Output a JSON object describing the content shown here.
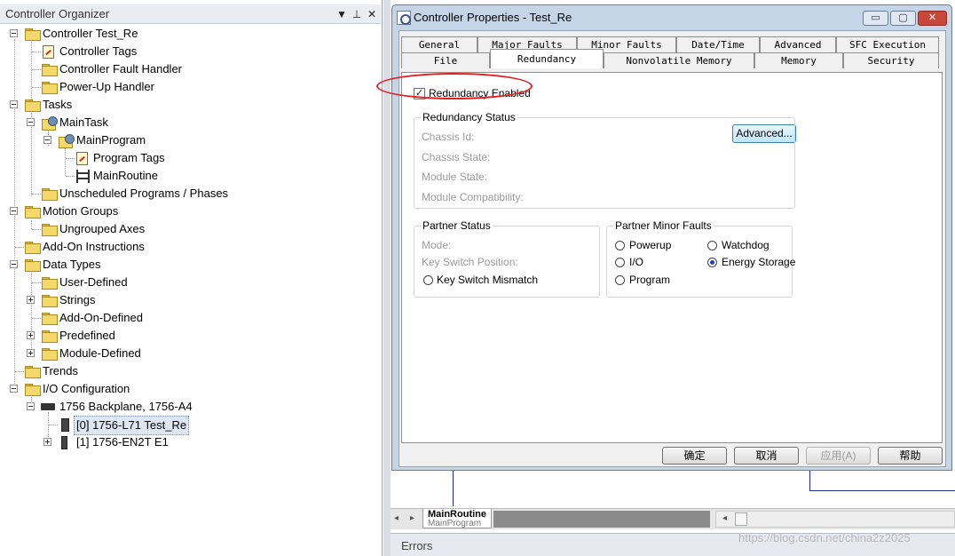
{
  "organizer": {
    "title": "Controller Organizer",
    "pin_glyph": "▼ ⊥",
    "close_glyph": "✕",
    "tree": {
      "controller": "Controller Test_Re",
      "controller_tags": "Controller Tags",
      "fault_handler": "Controller Fault Handler",
      "powerup_handler": "Power-Up Handler",
      "tasks": "Tasks",
      "main_task": "MainTask",
      "main_program": "MainProgram",
      "program_tags": "Program Tags",
      "main_routine": "MainRoutine",
      "unscheduled": "Unscheduled Programs / Phases",
      "motion_groups": "Motion Groups",
      "ungrouped_axes": "Ungrouped Axes",
      "add_on_instructions": "Add-On Instructions",
      "data_types": "Data Types",
      "user_defined": "User-Defined",
      "strings": "Strings",
      "add_on_defined": "Add-On-Defined",
      "predefined": "Predefined",
      "module_defined": "Module-Defined",
      "trends": "Trends",
      "io_configuration": "I/O Configuration",
      "backplane": "1756 Backplane, 1756-A4",
      "slot0": "[0] 1756-L71 Test_Re",
      "slot1": "[1] 1756-EN2T E1"
    }
  },
  "dialog": {
    "title": "Controller Properties - Test_Re",
    "window_buttons": {
      "minimize": "▭",
      "maximize": "▢",
      "close": "✕"
    },
    "tabs_row1": [
      "General",
      "Major Faults",
      "Minor Faults",
      "Date/Time",
      "Advanced",
      "SFC Execution"
    ],
    "tabs_row2": [
      "File",
      "Redundancy",
      "Nonvolatile Memory",
      "Memory",
      "Security"
    ],
    "active_tab": "Redundancy",
    "redundancy_enabled": {
      "label": "Redundancy Enabled",
      "checked": true
    },
    "advanced_button": "Advanced...",
    "redundancy_status": {
      "title": "Redundancy Status",
      "chassis_id": "Chassis Id:",
      "chassis_state": "Chassis State:",
      "module_state": "Module State:",
      "module_compat": "Module Compatibility:"
    },
    "partner_status": {
      "title": "Partner Status",
      "mode": "Mode:",
      "key_switch_position": "Key Switch Position:",
      "key_switch_mismatch": "Key Switch Mismatch"
    },
    "partner_minor_faults": {
      "title": "Partner Minor Faults",
      "powerup": "Powerup",
      "watchdog": "Watchdog",
      "io": "I/O",
      "energy_storage": "Energy Storage",
      "program": "Program",
      "selected": "Energy Storage"
    },
    "buttons": {
      "ok": "确定",
      "cancel": "取消",
      "apply": "应用(A)",
      "help": "帮助"
    }
  },
  "editor": {
    "routine_tab": "MainRoutine",
    "routine_program": "MainProgram",
    "errors_label": "Errors",
    "watermark": "https://blog.csdn.net/china2z2025"
  },
  "colors": {
    "dialog_frame": "#c5d4e6",
    "annotation_ellipse": "#e02020",
    "radio_selected": "#1a3fbf"
  }
}
